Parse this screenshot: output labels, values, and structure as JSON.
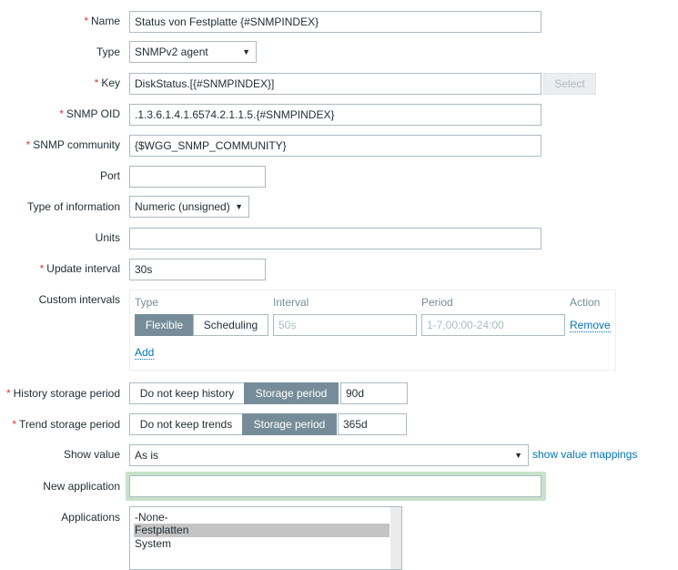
{
  "fields": {
    "name": {
      "label": "Name",
      "value": "Status von Festplatte {#SNMPINDEX}"
    },
    "type": {
      "label": "Type",
      "value": "SNMPv2 agent"
    },
    "key": {
      "label": "Key",
      "value": "DiskStatus.[{#SNMPINDEX}]",
      "select_button": "Select"
    },
    "oid": {
      "label": "SNMP OID",
      "value": ".1.3.6.1.4.1.6574.2.1.1.5.{#SNMPINDEX}"
    },
    "community": {
      "label": "SNMP community",
      "value": "{$WGG_SNMP_COMMUNITY}"
    },
    "port": {
      "label": "Port",
      "value": ""
    },
    "info": {
      "label": "Type of information",
      "value": "Numeric (unsigned)"
    },
    "units": {
      "label": "Units",
      "value": ""
    },
    "update": {
      "label": "Update interval",
      "value": "30s"
    },
    "custom": {
      "label": "Custom intervals",
      "headers": [
        "Type",
        "Interval",
        "Period",
        "Action"
      ],
      "flexible": "Flexible",
      "scheduling": "Scheduling",
      "interval_placeholder": "50s",
      "period_placeholder": "1-7,00:00-24:00",
      "remove": "Remove",
      "add": "Add"
    },
    "history": {
      "label": "History storage period",
      "off": "Do not keep history",
      "on": "Storage period",
      "value": "90d"
    },
    "trend": {
      "label": "Trend storage period",
      "off": "Do not keep trends",
      "on": "Storage period",
      "value": "365d"
    },
    "show": {
      "label": "Show value",
      "value": "As is",
      "link": "show value mappings"
    },
    "newapp": {
      "label": "New application",
      "value": ""
    },
    "apps": {
      "label": "Applications",
      "items": [
        "-None-",
        "Festplatten",
        "System"
      ],
      "selected": "Festplatten"
    }
  },
  "arrow": "▼",
  "required_mark": "*"
}
